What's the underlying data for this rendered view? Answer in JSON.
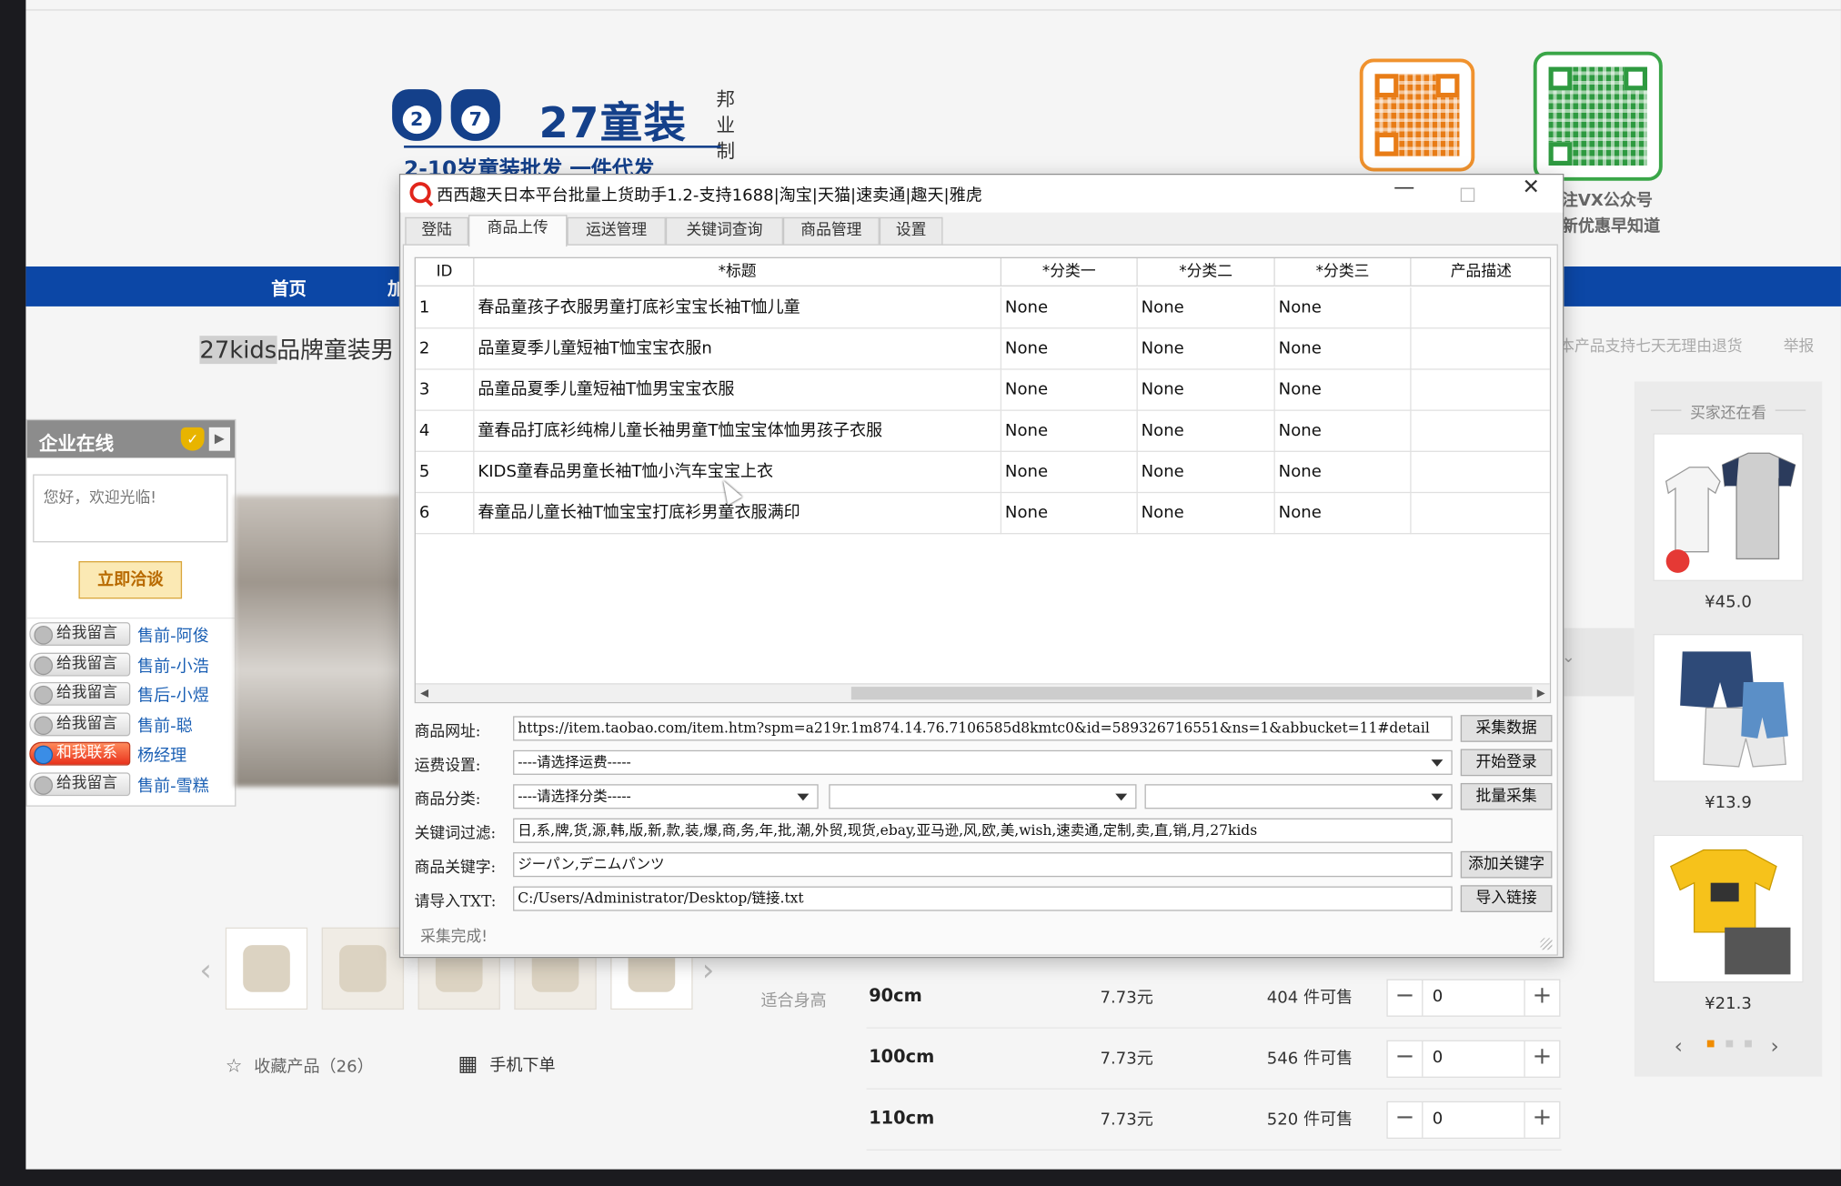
{
  "website": {
    "brand_name": "27童装",
    "brand_side_text": "邦业制",
    "brand_tagline": "2-10岁童装批发 一件代发",
    "qr_caption_line1": "注VX公众号",
    "qr_caption_line2": "新优惠早知道",
    "nav": [
      "首页",
      "加"
    ],
    "product_title_highlight": "27kids",
    "product_title_rest": "品牌童装男",
    "return_note": "本产品支持七天无理由退货",
    "report_link": "举报",
    "chat": {
      "header": "企业在线",
      "greeting": "您好，欢迎光临!",
      "talk_button": "立即洽谈",
      "staff": [
        {
          "button": "给我留言",
          "name": "售前-阿俊",
          "style": "gray"
        },
        {
          "button": "给我留言",
          "name": "售前-小浩",
          "style": "gray"
        },
        {
          "button": "给我留言",
          "name": "售后-小煜",
          "style": "gray"
        },
        {
          "button": "给我留言",
          "name": "售前-聪",
          "style": "gray"
        },
        {
          "button": "和我联系",
          "name": "杨经理",
          "style": "red"
        },
        {
          "button": "给我留言",
          "name": "售前-雪糕",
          "style": "gray"
        }
      ]
    },
    "favorite": "收藏产品（26）",
    "mobile_order": "手机下单",
    "size_label": "适合身高",
    "sizes": [
      {
        "size": "90cm",
        "price": "7.73元",
        "stock": "404 件可售",
        "qty": "0"
      },
      {
        "size": "100cm",
        "price": "7.73元",
        "stock": "546 件可售",
        "qty": "0"
      },
      {
        "size": "110cm",
        "price": "7.73元",
        "stock": "520 件可售",
        "qty": "0"
      }
    ],
    "reco": {
      "title": "买家还在看",
      "prices": [
        "¥45.0",
        "¥13.9",
        "¥21.3"
      ]
    },
    "colors": {
      "nav_blue": "#0c47a6",
      "qr_orange": "#f0922e",
      "qr_green": "#3aa648"
    }
  },
  "app": {
    "title": "西西趣天日本平台批量上货助手1.2-支持1688|淘宝|天猫|速卖通|趣天|雅虎",
    "window_buttons": {
      "minimize": "—",
      "close": "✕"
    },
    "tabs": [
      "登陆",
      "商品上传",
      "运送管理",
      "关键词查询",
      "商品管理",
      "设置"
    ],
    "active_tab": "商品上传",
    "table": {
      "columns": [
        "ID",
        "*标题",
        "*分类一",
        "*分类二",
        "*分类三",
        "产品描述"
      ],
      "rows": [
        {
          "id": "1",
          "title": "春品童孩子衣服男童打底衫宝宝长袖T恤儿童",
          "c1": "None",
          "c2": "None",
          "c3": "None",
          "desc": ""
        },
        {
          "id": "2",
          "title": "品童夏季儿童短袖T恤宝宝衣服n",
          "c1": "None",
          "c2": "None",
          "c3": "None",
          "desc": ""
        },
        {
          "id": "3",
          "title": "品童品夏季儿童短袖T恤男宝宝衣服",
          "c1": "None",
          "c2": "None",
          "c3": "None",
          "desc": ""
        },
        {
          "id": "4",
          "title": "童春品打底衫纯棉儿童长袖男童T恤宝宝体恤男孩子衣服",
          "c1": "None",
          "c2": "None",
          "c3": "None",
          "desc": ""
        },
        {
          "id": "5",
          "title": "KIDS童春品男童长袖T恤小汽车宝宝上衣",
          "c1": "None",
          "c2": "None",
          "c3": "None",
          "desc": ""
        },
        {
          "id": "6",
          "title": "春童品儿童长袖T恤宝宝打底衫男童衣服满印",
          "c1": "None",
          "c2": "None",
          "c3": "None",
          "desc": ""
        }
      ]
    },
    "form": {
      "url_label": "商品网址:",
      "url_value": "https://item.taobao.com/item.htm?spm=a219r.1m874.14.76.7106585d8kmtc0&id=589326716551&ns=1&abbucket=11#detail",
      "collect_button": "采集数据",
      "shipping_label": "运费设置:",
      "shipping_value": "----请选择运费-----",
      "login_button": "开始登录",
      "category_label": "商品分类:",
      "category_value": "----请选择分类-----",
      "category2_value": "",
      "category3_value": "",
      "batch_button": "批量采集",
      "filter_label": "关键词过滤:",
      "filter_value": "日,系,牌,货,源,韩,版,新,款,装,爆,商,务,年,批,潮,外贸,现货,ebay,亚马逊,风,欧,美,wish,速卖通,定制,卖,直,销,月,27kids",
      "keyword_label": "商品关键字:",
      "keyword_value": "ジーパン,デニムパンツ",
      "add_keyword_button": "添加关键字",
      "txt_label": "请导入TXT:",
      "txt_value": "C:/Users/Administrator/Desktop/链接.txt",
      "import_button": "导入链接"
    },
    "status": "采集完成!"
  }
}
